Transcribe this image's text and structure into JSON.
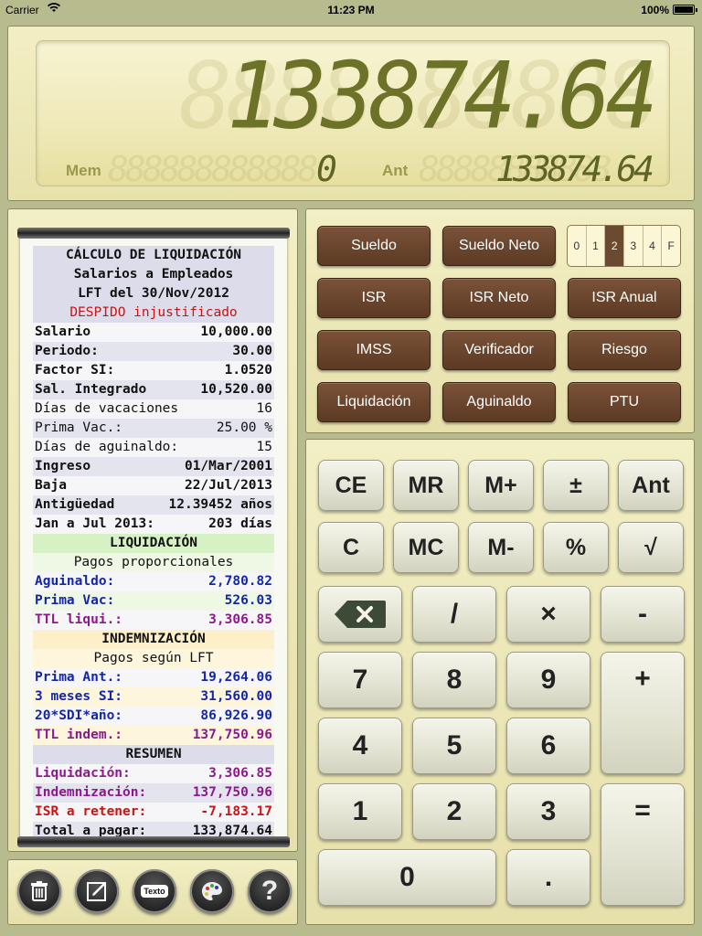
{
  "status": {
    "carrier": "Carrier",
    "time": "11:23 PM",
    "battery": "100%"
  },
  "display": {
    "main_ghost": "8888888888",
    "main": "133874.64",
    "mem_label": "Mem",
    "mem_ghost": "888888888888",
    "mem_value": "0",
    "ant_label": "Ant",
    "ant_ghost": "88888888888",
    "ant_value": "133874.64"
  },
  "receipt": [
    {
      "left": "CÁLCULO DE LIQUIDACIÓN",
      "right": "",
      "style": "center bold bg-header c-black"
    },
    {
      "left": "Salarios a Empleados",
      "right": "",
      "style": "center bold bg-header c-black"
    },
    {
      "left": "LFT del 30/Nov/2012",
      "right": "",
      "style": "center bold bg-header c-black"
    },
    {
      "left": "DESPIDO injustificado",
      "right": "",
      "style": "center bg-header c-red"
    },
    {
      "left": "Salario",
      "right": "10,000.00",
      "style": "bold bg-white c-black"
    },
    {
      "left": "Periodo:",
      "right": "30.00",
      "style": "bold bg-lilac c-black"
    },
    {
      "left": "Factor SI:",
      "right": "1.0520",
      "style": "bold bg-white c-black"
    },
    {
      "left": "Sal. Integrado",
      "right": "10,520.00",
      "style": "bold bg-lilac c-black"
    },
    {
      "left": "Días de vacaciones",
      "right": "16",
      "style": "bg-white c-black"
    },
    {
      "left": "Prima Vac.:",
      "right": "25.00 %",
      "style": "bg-lilac c-black"
    },
    {
      "left": "Días de aguinaldo:",
      "right": "15",
      "style": "bg-white c-black"
    },
    {
      "left": "Ingreso",
      "right": "01/Mar/2001",
      "style": "bold bg-lilac c-black"
    },
    {
      "left": "Baja",
      "right": "22/Jul/2013",
      "style": "bold bg-white c-black"
    },
    {
      "left": "Antigüedad",
      "right": "12.39452 años",
      "style": "bold bg-lilac c-black"
    },
    {
      "left": "Jan a Jul 2013:",
      "right": "203 días",
      "style": "bold bg-white c-black"
    },
    {
      "left": "LIQUIDACIÓN",
      "right": "",
      "style": "center bold bg-green c-black"
    },
    {
      "left": "Pagos proporcionales",
      "right": "",
      "style": "center bg-green-light c-black"
    },
    {
      "left": "Aguinaldo:",
      "right": "2,780.82",
      "style": "bold bg-white c-blue"
    },
    {
      "left": "Prima Vac:",
      "right": "526.03",
      "style": "bold bg-green-light c-blue"
    },
    {
      "left": "TTL liqui.:",
      "right": "3,306.85",
      "style": "bold bg-white c-purple"
    },
    {
      "left": "INDEMNIZACIÓN",
      "right": "",
      "style": "center bold bg-yellow c-black"
    },
    {
      "left": "Pagos según LFT",
      "right": "",
      "style": "center bg-yellow-light c-black"
    },
    {
      "left": "Prima Ant.:",
      "right": "19,264.06",
      "style": "bold bg-white c-blue"
    },
    {
      "left": "3 meses SI:",
      "right": "31,560.00",
      "style": "bold bg-yellow-light c-blue"
    },
    {
      "left": "20*SDI*año:",
      "right": "86,926.90",
      "style": "bold bg-white c-blue"
    },
    {
      "left": "TTL indem.:",
      "right": "137,750.96",
      "style": "bold bg-yellow-light c-purple"
    },
    {
      "left": "RESUMEN",
      "right": "",
      "style": "center bold bg-header c-black"
    },
    {
      "left": "Liquidación:",
      "right": "3,306.85",
      "style": "bold bg-white c-purple"
    },
    {
      "left": "Indemnización:",
      "right": "137,750.96",
      "style": "bold bg-lilac c-purple"
    },
    {
      "left": "ISR a retener:",
      "right": "-7,183.17",
      "style": "bold bg-white c-red"
    },
    {
      "left": "Total a pagar:",
      "right": "133,874.64",
      "style": "bold bg-lilac c-black"
    }
  ],
  "toolbar": {
    "texto_label": "Texto",
    "help_label": "?"
  },
  "functions": {
    "sueldo": "Sueldo",
    "sueldo_neto": "Sueldo Neto",
    "isr": "ISR",
    "isr_neto": "ISR Neto",
    "isr_anual": "ISR Anual",
    "imss": "IMSS",
    "verificador": "Verificador",
    "riesgo": "Riesgo",
    "liquidacion": "Liquidación",
    "aguinaldo": "Aguinaldo",
    "ptu": "PTU",
    "decimals": [
      "0",
      "1",
      "2",
      "3",
      "4",
      "F"
    ],
    "decimals_selected": "2"
  },
  "keys": {
    "ce": "CE",
    "mr": "MR",
    "mplus": "M+",
    "plusminus": "±",
    "ant": "Ant",
    "c": "C",
    "mc": "MC",
    "mminus": "M-",
    "percent": "%",
    "sqrt": "√",
    "divide": "/",
    "multiply": "×",
    "minus": "-",
    "plus": "+",
    "equals": "=",
    "k7": "7",
    "k8": "8",
    "k9": "9",
    "k4": "4",
    "k5": "5",
    "k6": "6",
    "k1": "1",
    "k2": "2",
    "k3": "3",
    "k0": "0",
    "dot": "."
  },
  "colors": {
    "accent_brown": "#6b4a30",
    "lcd_digit": "#6d7229",
    "panel": "#efe9b9"
  }
}
